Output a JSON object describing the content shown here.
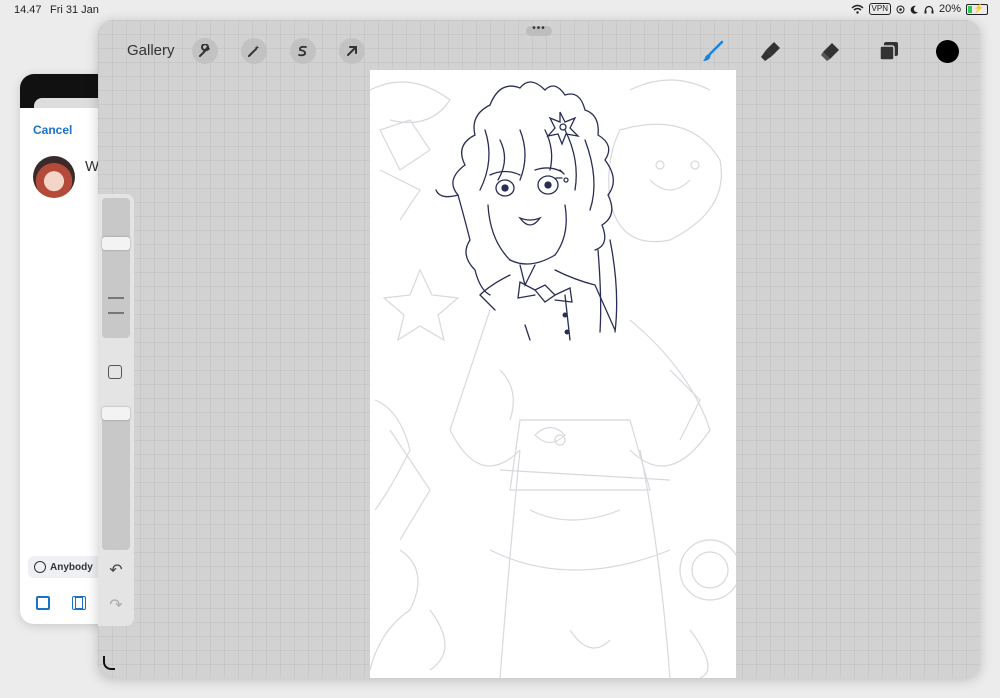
{
  "status_bar": {
    "time": "14.47",
    "date": "Fri 31 Jan",
    "vpn_label": "VPN",
    "battery": "20%",
    "icons": [
      "wifi-icon",
      "vpn-icon",
      "focus-icon",
      "moon-icon",
      "headphones-icon",
      "battery-charging-icon"
    ]
  },
  "share_sheet": {
    "cancel_label": "Cancel",
    "title_partial": "W",
    "audience_label": "Anybody",
    "bottom_icons": [
      "photo-icon",
      "film-icon"
    ]
  },
  "procreate": {
    "gallery_label": "Gallery",
    "multitask_label": "•••",
    "left_tools": [
      "wrench-icon",
      "magic-wand-icon",
      "selection-icon",
      "transform-arrow-icon"
    ],
    "right_tools": [
      "brush-icon",
      "smudge-icon",
      "eraser-icon",
      "layers-icon"
    ],
    "active_tool": "brush-icon",
    "colors": {
      "accent": "#1a84d8",
      "current_color": "#000000",
      "canvas": "#ffffff",
      "background": "#d2d2d3"
    },
    "side_panel": {
      "brush_size_level": 0.22,
      "opacity_level": 0.0,
      "icons": [
        "modify-square-icon",
        "undo-icon",
        "redo-icon"
      ]
    }
  }
}
